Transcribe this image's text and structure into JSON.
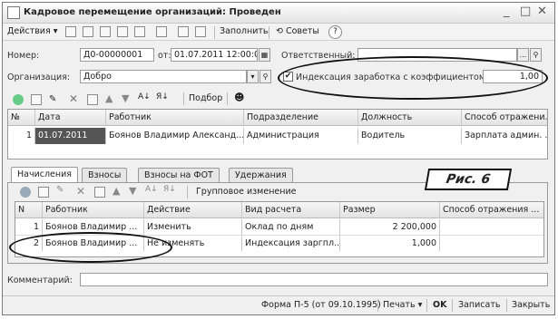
{
  "window": {
    "title": "Кадровое перемещение организаций: Проведен",
    "min": "_",
    "max": "□",
    "close": "✕"
  },
  "toolbar": {
    "actions": "Действия",
    "fill": "Заполнить",
    "tips": "Советы",
    "help": "?"
  },
  "form": {
    "number_label": "Номер:",
    "number": "Д0-00000001",
    "from_label": "от:",
    "date": "01.07.2011 12:00:00",
    "responsible_label": "Ответственный:",
    "responsible": "",
    "org_label": "Организация:",
    "org": "Добро",
    "indexation_label": "Индексация заработка с коэффициентом:",
    "indexation_value": "1,00"
  },
  "grid1": {
    "select_label": "Подбор",
    "headers": [
      "№",
      "Дата",
      "Работник",
      "Подразделение",
      "Должность",
      "Способ отражени..."
    ],
    "rows": [
      [
        "1",
        "01.07.2011",
        "Боянов Владимир Александ...",
        "Администрация",
        "Водитель",
        "Зарплата админ. ..."
      ]
    ]
  },
  "tabs": [
    "Начисления",
    "Взносы",
    "Взносы на ФОТ",
    "Удержания"
  ],
  "grid2": {
    "group_change_label": "Групповое изменение",
    "headers": [
      "N",
      "Работник",
      "Действие",
      "Вид расчета",
      "Размер",
      "Способ отражения ..."
    ],
    "rows": [
      [
        "1",
        "Боянов Владимир ...",
        "Изменить",
        "Оклад по дням",
        "2 200,000",
        ""
      ],
      [
        "2",
        "Боянов Владимир ...",
        "Не изменять",
        "Индексация заргпл...",
        "1,000",
        ""
      ]
    ]
  },
  "comment": {
    "label": "Комментарий:",
    "value": ""
  },
  "status": {
    "form": "Форма П-5 (от 09.10.1995)",
    "print": "Печать",
    "ok": "OK",
    "save": "Записать",
    "close": "Закрыть"
  },
  "annotation": {
    "label": "Рис. 6"
  }
}
